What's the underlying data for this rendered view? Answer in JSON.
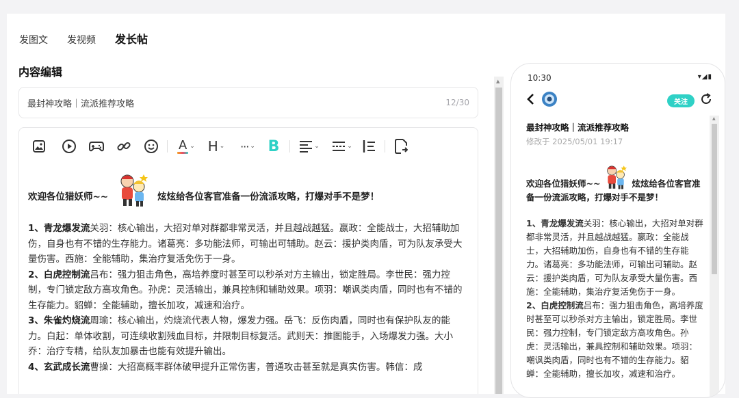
{
  "tabs": [
    {
      "label": "发图文",
      "active": false
    },
    {
      "label": "发视频",
      "active": false
    },
    {
      "label": "发长帖",
      "active": true
    }
  ],
  "section_title": "内容编辑",
  "title_input": {
    "value": "最封神攻略｜流派推荐攻略",
    "counter": "12/30"
  },
  "toolbar": {
    "icons": [
      "image-icon",
      "video-icon",
      "gamepad-icon",
      "link-icon",
      "emoji-icon",
      "font-color-icon",
      "heading-icon",
      "more-icon",
      "bold-icon",
      "align-icon",
      "divider-style-icon",
      "quote-icon",
      "export-icon"
    ],
    "heading_label": "H",
    "bold_label": "B",
    "font_color_label": "A",
    "more_label": "···"
  },
  "content": {
    "greet_before": "欢迎各位猎妖师~~",
    "greet_after": "炫炫给各位客官准备一份流派攻略，打爆对手不是梦！",
    "paragraphs": [
      {
        "head": "1、青龙爆发流",
        "body": "关羽：核心输出，大招对单对群都非常灵活，并且越战越猛。嬴政：全能战士，大招辅助加伤，自身也有不错的生存能力。诸葛亮：多功能法师，可输出可辅助。赵云：援护类肉盾，可为队友承受大量伤害。西施：全能辅助，集治疗复活免伤于一身。"
      },
      {
        "head": "2、白虎控制流",
        "body": "吕布：强力狙击角色，高培养度时甚至可以秒杀对方主输出，锁定胜局。李世民：强力控制，专门锁定敌方高攻角色。孙虎：灵活输出，兼具控制和辅助效果。项羽：嘲讽类肉盾，同时也有不错的生存能力。貂蝉：全能辅助，擅长加攻，减速和治疗。"
      },
      {
        "head": "3、朱雀灼烧流",
        "body": "周瑜：核心输出，灼烧流代表人物，爆发力强。岳飞：反伤肉盾，同时也有保护队友的能力。白起：单体收割，可连续收割残血目标，并限制目标复活。武则天：推图能手，入场爆发力强。大小乔：治疗专精，给队友加暴击也能有效提升输出。"
      },
      {
        "head": "4、玄武成长流",
        "body": "曹操：大招高概率群体破甲提升正常伤害，普通攻击甚至就是真实伤害。韩信：成"
      }
    ]
  },
  "preview": {
    "time": "10:30",
    "status_icons": "▾◢▮",
    "follow_label": "关注",
    "title": "最封神攻略｜流派推荐攻略",
    "date": "修改于 2025/05/01 19:17",
    "greet_before": "欢迎各位猎妖师~~",
    "greet_after": "炫炫给各位客官准备一份流派攻略，打爆对手不是梦！",
    "paragraphs": [
      {
        "head": "1、青龙爆发流",
        "body": "关羽：核心输出，大招对单对群都非常灵活，并且越战越猛。嬴政：全能战士，大招辅助加伤，自身也有不错的生存能力。诸葛亮：多功能法师，可输出可辅助。赵云：援护类肉盾，可为队友承受大量伤害。西施：全能辅助，集治疗复活免伤于一身。"
      },
      {
        "head": "2、白虎控制流",
        "body": "吕布：强力狙击角色，高培养度时甚至可以秒杀对方主输出，锁定胜局。李世民：强力控制，专门锁定敌方高攻角色。孙虎：灵活输出，兼具控制和辅助效果。项羽：嘲讽类肉盾，同时也有不错的生存能力。貂蝉：全能辅助，擅长加攻，减速和治疗。"
      }
    ]
  },
  "colors": {
    "accent": "#2fd1c6",
    "text": "#333333",
    "muted": "#a7a7ad"
  }
}
